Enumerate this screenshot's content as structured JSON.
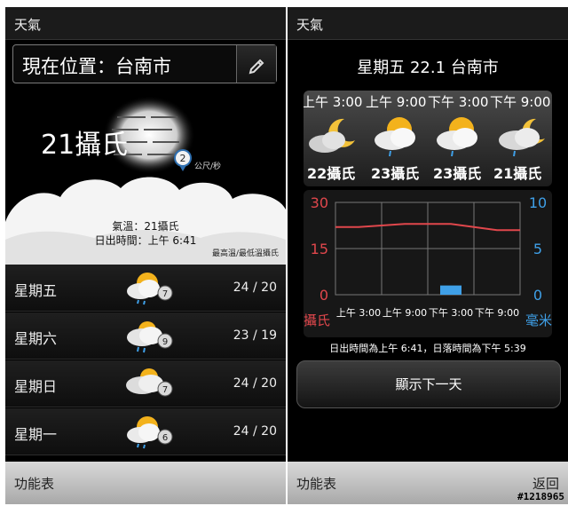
{
  "left": {
    "title": "天氣",
    "location": "現在位置：台南市",
    "current": {
      "temp": "21攝氏",
      "wind_speed": "2",
      "wind_unit": "公尺/秒",
      "feels_like": "氣溫：21攝氏",
      "sunrise": "日出時間：上午 6:41",
      "note": "最高溫/最低溫攝氏"
    },
    "forecast": [
      {
        "day": "星期五",
        "hilo": "24 / 20",
        "wind": "7",
        "icon": "sun-cloud-rain-icon"
      },
      {
        "day": "星期六",
        "hilo": "23 / 19",
        "wind": "9",
        "icon": "cloud-rain-icon"
      },
      {
        "day": "星期日",
        "hilo": "24 / 20",
        "wind": "7",
        "icon": "cloudy-icon"
      },
      {
        "day": "星期一",
        "hilo": "24 / 20",
        "wind": "6",
        "icon": "sun-cloud-rain-icon"
      }
    ],
    "softkey": "功能表"
  },
  "right": {
    "title": "天氣",
    "date_title": "星期五 22.1 台南市",
    "hourly": [
      {
        "time": "上午 3:00",
        "temp": "22攝氏",
        "icon": "moon-cloud-icon"
      },
      {
        "time": "上午 9:00",
        "temp": "23攝氏",
        "icon": "sun-cloud-rain-icon"
      },
      {
        "time": "下午 3:00",
        "temp": "23攝氏",
        "icon": "sun-cloud-rain-icon"
      },
      {
        "time": "下午 9:00",
        "temp": "21攝氏",
        "icon": "moon-cloud-rain-icon"
      }
    ],
    "sun_times": "日出時間為上午 6:41，日落時間為下午 5:39",
    "next_day_label": "顯示下一天",
    "softkey_left": "功能表",
    "softkey_right": "返回"
  },
  "chart_data": {
    "type": "line",
    "title": "",
    "categories": [
      "上午 3:00",
      "上午 9:00",
      "下午 3:00",
      "下午 9:00"
    ],
    "left_axis": {
      "label": "攝氏",
      "ticks": [
        "30",
        "15",
        "0"
      ],
      "ylim": [
        0,
        30
      ],
      "color": "#e0474c"
    },
    "right_axis": {
      "label": "毫米",
      "ticks": [
        "10",
        "5",
        "0"
      ],
      "ylim": [
        0,
        10
      ],
      "color": "#3fa0e8"
    },
    "series": [
      {
        "name": "",
        "type": "line",
        "axis": "left",
        "values": [
          22,
          23,
          23,
          21
        ],
        "color": "#e0474c"
      },
      {
        "name": "",
        "type": "bar",
        "axis": "right",
        "values": [
          0,
          0,
          1,
          0
        ],
        "color": "#3fa0e8"
      }
    ],
    "grid": true
  },
  "watermark": "#1218965"
}
